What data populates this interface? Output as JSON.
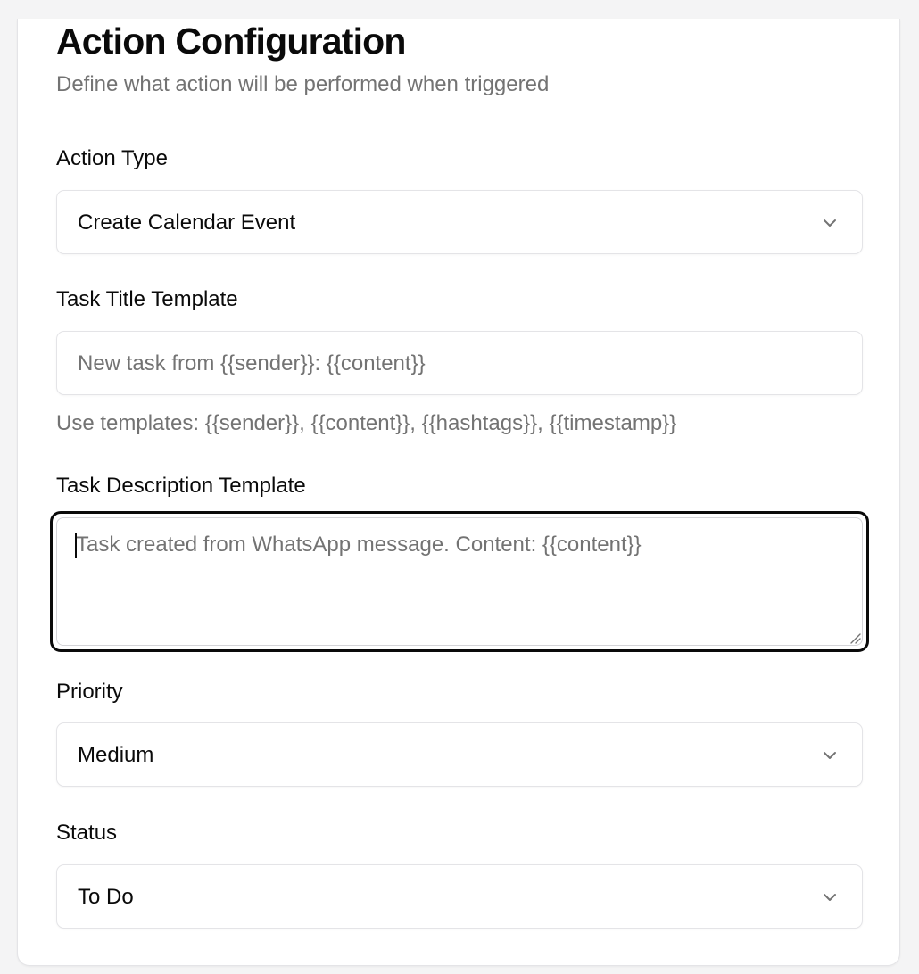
{
  "header": {
    "title": "Action Configuration",
    "subtitle": "Define what action will be performed when triggered"
  },
  "action_type": {
    "label": "Action Type",
    "value": "Create Calendar Event",
    "icon": "chevron-down-icon"
  },
  "task_title": {
    "label": "Task Title Template",
    "placeholder": "New task from {{sender}}: {{content}}",
    "hint": "Use templates: {{sender}}, {{content}}, {{hashtags}}, {{timestamp}}"
  },
  "task_description": {
    "label": "Task Description Template",
    "placeholder": "Task created from WhatsApp message. Content: {{content}}"
  },
  "priority": {
    "label": "Priority",
    "value": "Medium",
    "icon": "chevron-down-icon"
  },
  "status": {
    "label": "Status",
    "value": "To Do",
    "icon": "chevron-down-icon"
  },
  "colors": {
    "text": "#0a0a0a",
    "muted": "#737373",
    "border": "#e4e4e7",
    "focus_ring": "#0a0a0a",
    "background": "#f4f4f5",
    "card": "#ffffff"
  }
}
